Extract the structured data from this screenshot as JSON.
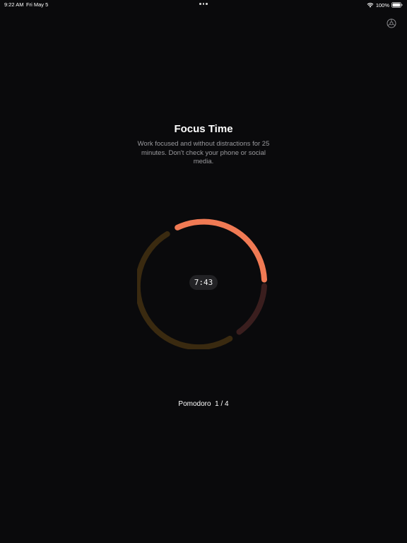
{
  "status_bar": {
    "time": "9:22 AM",
    "date": "Fri May 5",
    "battery": "100%",
    "icons": [
      "wifi-icon",
      "battery-icon",
      "multitasking-dots-icon"
    ]
  },
  "header": {
    "settings_icon": "gear-icon"
  },
  "focus": {
    "title": "Focus Time",
    "description": "Work focused and without distractions for 25 minutes. Don't check your phone or social media."
  },
  "timer": {
    "display": "7:43",
    "colors": {
      "active": "#f07a54",
      "upcoming_short_break": "#3a1e1e",
      "upcoming_long_break": "#3a2a10"
    }
  },
  "session": {
    "label": "Pomodoro",
    "counter": "1 / 4"
  }
}
